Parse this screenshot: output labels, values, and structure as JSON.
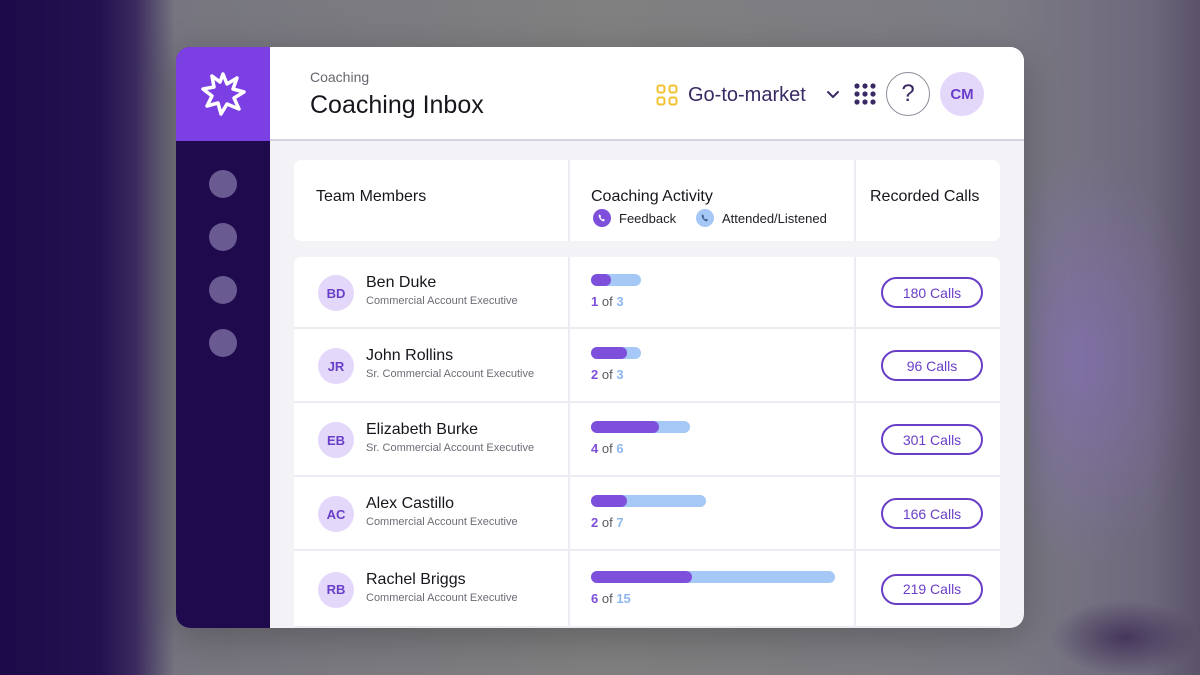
{
  "header": {
    "breadcrumb": "Coaching",
    "title": "Coaching Inbox",
    "workspace": "Go-to-market",
    "user_initials": "CM",
    "help": "?"
  },
  "icons": {
    "logo": "starburst-logo-icon",
    "workspace": "grid-squares-icon",
    "apps": "apps-grid-icon",
    "help": "question-icon"
  },
  "colors": {
    "brand_purple": "#7b3fe4",
    "sidebar": "#1e0a4d",
    "feedback": "#7d4fdb",
    "attended": "#a6c8f6",
    "workspace_icon": "#f2c230"
  },
  "table": {
    "columns": [
      "Team Members",
      "Coaching Activity",
      "Recorded Calls"
    ],
    "legend": {
      "feedback": "Feedback",
      "attended": "Attended/Listened"
    },
    "rows": [
      {
        "initials": "BD",
        "name": "Ben Duke",
        "role": "Commercial Account Executive",
        "feedback": 1,
        "total": 3,
        "of_label": "of",
        "calls": "180 Calls"
      },
      {
        "initials": "JR",
        "name": "John Rollins",
        "role": "Sr. Commercial Account Executive",
        "feedback": 2,
        "total": 3,
        "of_label": "of",
        "calls": "96 Calls"
      },
      {
        "initials": "EB",
        "name": "Elizabeth Burke",
        "role": "Sr. Commercial Account Executive",
        "feedback": 4,
        "total": 6,
        "of_label": "of",
        "calls": "301 Calls"
      },
      {
        "initials": "AC",
        "name": "Alex Castillo",
        "role": "Commercial Account Executive",
        "feedback": 2,
        "total": 7,
        "of_label": "of",
        "calls": "166 Calls"
      },
      {
        "initials": "RB",
        "name": "Rachel Briggs",
        "role": "Commercial Account Executive",
        "feedback": 6,
        "total": 15,
        "of_label": "of",
        "calls": "219 Calls"
      }
    ]
  }
}
